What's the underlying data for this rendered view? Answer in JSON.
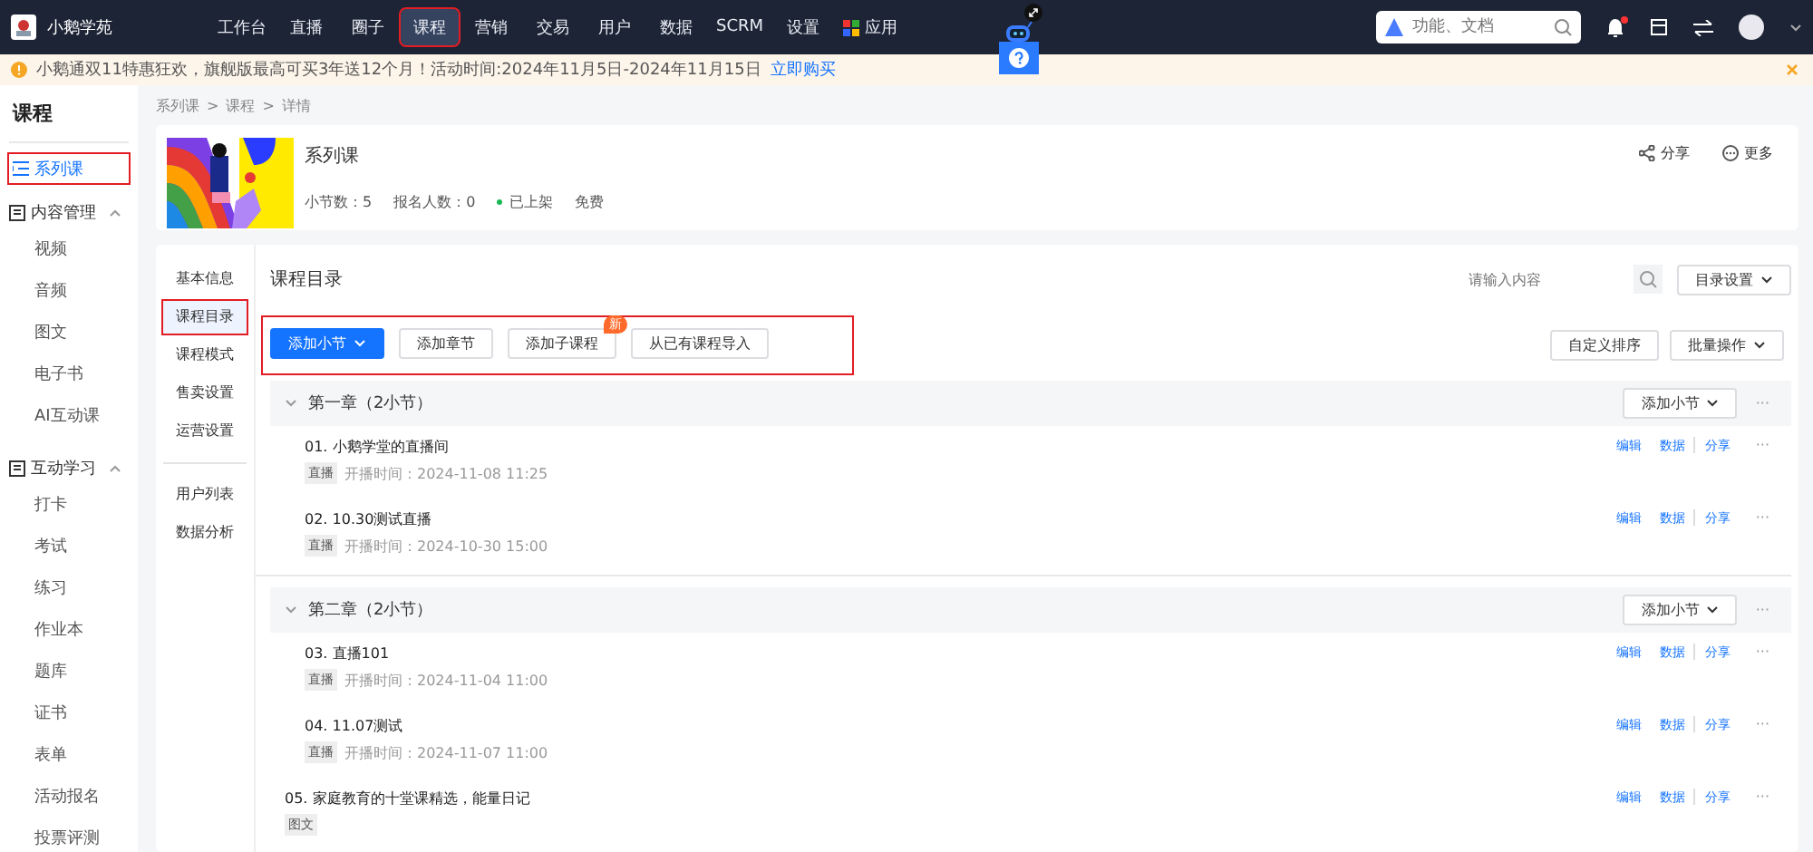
{
  "topnav": {
    "logo": "小鹅学苑",
    "items": [
      {
        "label": "工作台",
        "selected": false,
        "highlighted": false
      },
      {
        "label": "直播",
        "selected": false,
        "highlighted": false
      },
      {
        "label": "圈子",
        "selected": false,
        "highlighted": false
      },
      {
        "label": "课程",
        "selected": true,
        "highlighted": true
      },
      {
        "label": "营销",
        "selected": false,
        "highlighted": false
      },
      {
        "label": "交易",
        "selected": false,
        "highlighted": false
      },
      {
        "label": "用户",
        "selected": false,
        "highlighted": false
      },
      {
        "label": "数据",
        "selected": false,
        "highlighted": false
      },
      {
        "label": "SCRM",
        "selected": false,
        "highlighted": false
      },
      {
        "label": "设置",
        "selected": false,
        "highlighted": false
      },
      {
        "label": "应用",
        "selected": false,
        "highlighted": false
      }
    ],
    "search": {
      "placeholder": "功能、文档"
    },
    "notification_dot": true
  },
  "banner": {
    "text": "小鹅通双11特惠狂欢，旗舰版最高可买3年送12个月！活动时间:2024年11月5日-2024年11月15日",
    "link": "立即购买"
  },
  "sidebar": {
    "title": "课程",
    "items": [
      {
        "label": "系列课",
        "selected": true,
        "highlighted": true
      },
      {
        "label": "内容管理",
        "expanded": true,
        "children": [
          {
            "label": "视频"
          },
          {
            "label": "音频"
          },
          {
            "label": "图文"
          },
          {
            "label": "电子书"
          },
          {
            "label": "AI互动课"
          }
        ]
      },
      {
        "label": "互动学习",
        "expanded": true,
        "children": [
          {
            "label": "打卡"
          },
          {
            "label": "考试"
          },
          {
            "label": "练习"
          },
          {
            "label": "作业本"
          },
          {
            "label": "题库"
          },
          {
            "label": "证书"
          },
          {
            "label": "表单"
          },
          {
            "label": "活动报名"
          },
          {
            "label": "投票评测"
          }
        ]
      }
    ]
  },
  "breadcrumb": [
    {
      "label": "系列课"
    },
    {
      "separator": ">",
      "label": "课程"
    },
    {
      "separator": ">",
      "label": "详情"
    }
  ],
  "course": {
    "title": "系列课",
    "stats": [
      "小节数：5",
      "报名人数：0"
    ],
    "status": "已上架",
    "price": "免费",
    "actions": [
      "分享",
      "更多"
    ]
  },
  "tabs": [
    {
      "label": "基本信息",
      "selected": false,
      "highlighted": false
    },
    {
      "label": "课程目录",
      "selected": true,
      "highlighted": true
    },
    {
      "label": "课程模式",
      "selected": false,
      "highlighted": false
    },
    {
      "label": "售卖设置",
      "selected": false,
      "highlighted": false
    },
    {
      "label": "运营设置",
      "selected": false,
      "highlighted": false
    },
    {
      "label": "用户列表",
      "selected": false,
      "highlighted": false,
      "divider_before": true
    },
    {
      "label": "数据分析",
      "selected": false,
      "highlighted": false
    }
  ],
  "catalog": {
    "title": "课程目录",
    "search": {
      "placeholder": "请输入内容"
    },
    "filter": "目录设置",
    "toolbar_highlighted": true,
    "add_buttons": [
      {
        "label": "添加小节",
        "kind": "primary"
      },
      {
        "label": "添加章节",
        "kind": "plain"
      },
      {
        "label": "添加子课程",
        "kind": "plain",
        "badge": "新"
      },
      {
        "label": "从已有课程导入",
        "kind": "plain"
      }
    ],
    "right_buttons": [
      "自定义排序",
      "批量操作"
    ],
    "chapters": [
      {
        "title": "第一章（2小节）",
        "expanded": true,
        "add_label": "添加小节",
        "more": "···",
        "lessons": [
          {
            "title": "01. 小鹅学堂的直播间",
            "tag": "直播",
            "time": "开播时间：2024-11-08 11:25",
            "actions": [
              "编辑",
              "数据",
              "分享"
            ],
            "more": "···"
          },
          {
            "title": "02. 10.30测试直播",
            "tag": "直播",
            "time": "开播时间：2024-10-30 15:00",
            "actions": [
              "编辑",
              "数据",
              "分享"
            ],
            "more": "···"
          }
        ]
      },
      {
        "title": "第二章（2小节）",
        "expanded": true,
        "add_label": "添加小节",
        "more": "···",
        "lessons": [
          {
            "title": "03. 直播101",
            "tag": "直播",
            "time": "开播时间：2024-11-04 11:00",
            "actions": [
              "编辑",
              "数据",
              "分享"
            ],
            "more": "···"
          },
          {
            "title": "04. 11.07测试",
            "tag": "直播",
            "time": "开播时间：2024-11-07 11:00",
            "actions": [
              "编辑",
              "数据",
              "分享"
            ],
            "more": "···"
          }
        ]
      }
    ],
    "loose_lessons": [
      {
        "title": "05. 家庭教育的十堂课精选，能量日记",
        "tag": "图文",
        "actions": [
          "编辑",
          "数据",
          "分享"
        ],
        "more": "···"
      }
    ]
  }
}
